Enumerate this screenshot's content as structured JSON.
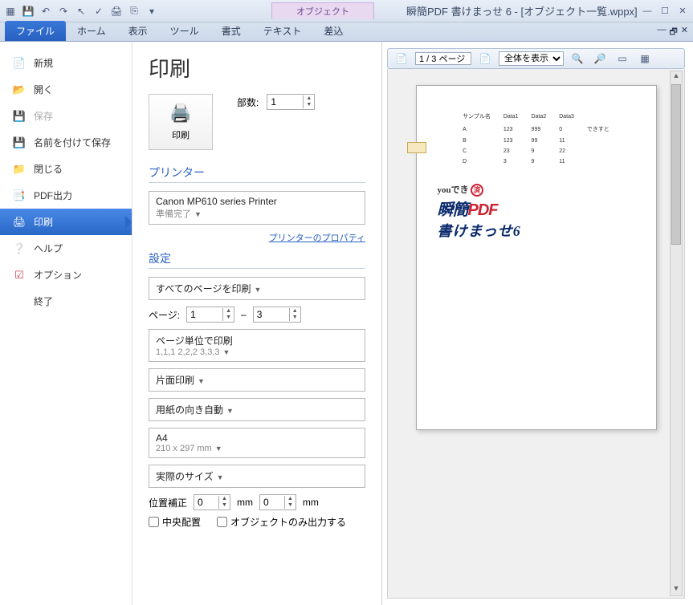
{
  "window": {
    "context_tab": "オブジェクト",
    "title": "瞬簡PDF 書けまっせ 6 - [オブジェクト一覧.wppx]"
  },
  "ribbon": {
    "file": "ファイル",
    "home": "ホーム",
    "view": "表示",
    "tool": "ツール",
    "format": "書式",
    "text": "テキスト",
    "merge": "差込"
  },
  "file_menu": {
    "new": "新規",
    "open": "開く",
    "save": "保存",
    "save_as": "名前を付けて保存",
    "close": "閉じる",
    "pdf_export": "PDF出力",
    "print": "印刷",
    "help": "ヘルプ",
    "options": "オプション",
    "exit": "終了"
  },
  "print": {
    "title": "印刷",
    "button": "印刷",
    "copies_label": "部数:",
    "copies_value": "1",
    "printer_section": "プリンター",
    "printer_name": "Canon MP610 series Printer",
    "printer_status": "準備完了",
    "printer_props": "プリンターのプロパティ",
    "settings_section": "設定",
    "print_all": "すべてのページを印刷",
    "page_label": "ページ:",
    "page_from": "1",
    "page_to": "3",
    "dash": "–",
    "page_unit": "ページ単位で印刷",
    "page_unit_sub": "1,1,1 2,2,2 3,3,3",
    "duplex": "片面印刷",
    "orientation": "用紙の向き自動",
    "paper": "A4",
    "paper_sub": "210 x 297 mm",
    "scale": "実際のサイズ",
    "offset_label": "位置補正",
    "offset_x": "0",
    "offset_y": "0",
    "mm": "mm",
    "center": "中央配置",
    "objects_only": "オブジェクトのみ出力する"
  },
  "preview": {
    "page_indicator": "1 / 3 ページ",
    "zoom_mode": "全体を表示",
    "sample_header": "サンプル名",
    "col1": "Data1",
    "col2": "Data2",
    "col3": "Data3",
    "rowA": "A",
    "rowB": "B",
    "rowC": "C",
    "rowD": "D",
    "note": "できすと",
    "you": "youでき",
    "stamp": "済",
    "logo1": "瞬簡",
    "logo2": "PDF",
    "logo3": "書けまっせ6"
  }
}
